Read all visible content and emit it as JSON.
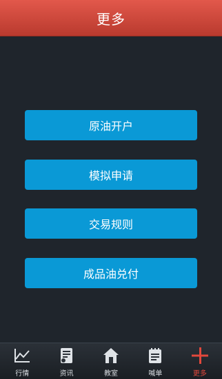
{
  "header": {
    "title": "更多"
  },
  "menu": {
    "items": [
      {
        "label": "原油开户"
      },
      {
        "label": "模拟申请"
      },
      {
        "label": "交易规则"
      },
      {
        "label": "成品油兑付"
      }
    ]
  },
  "tabbar": {
    "active_color": "#e2483c",
    "items": [
      {
        "label": "行情",
        "icon": "chart-icon"
      },
      {
        "label": "资讯",
        "icon": "news-icon"
      },
      {
        "label": "教室",
        "icon": "home-icon"
      },
      {
        "label": "喊单",
        "icon": "notepad-icon"
      },
      {
        "label": "更多",
        "icon": "plus-icon",
        "active": true
      }
    ]
  }
}
